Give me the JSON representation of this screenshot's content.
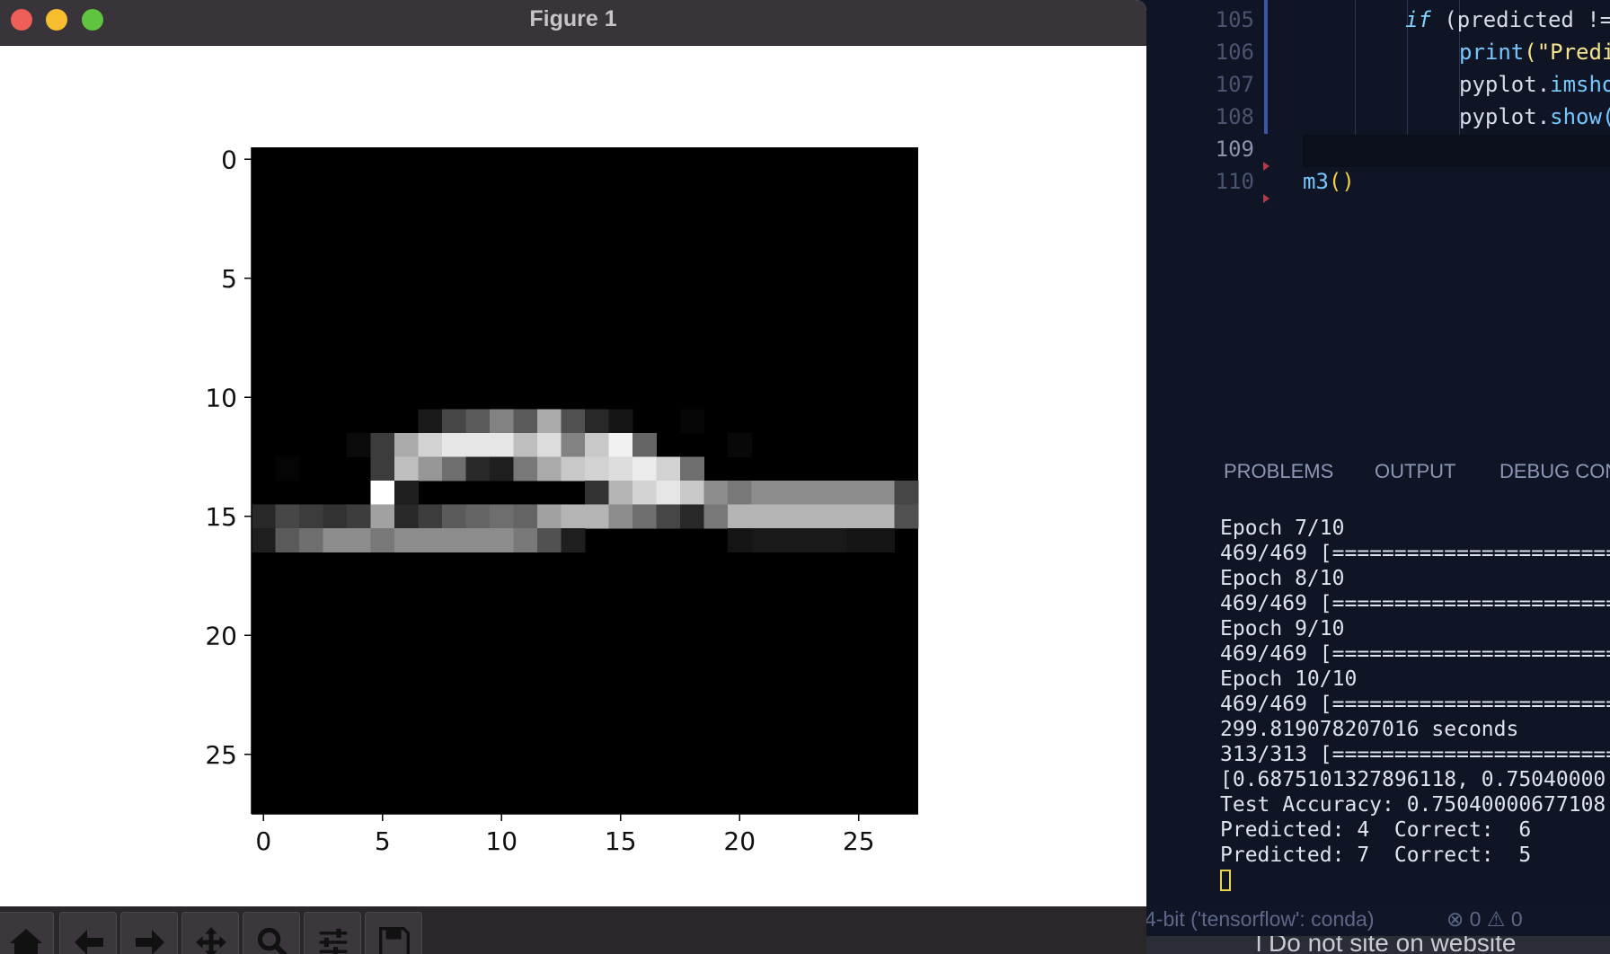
{
  "window": {
    "title": "Figure 1"
  },
  "chart_data": {
    "type": "heatmap",
    "colormap": "gray",
    "xticks": [
      0,
      5,
      10,
      15,
      20,
      25
    ],
    "yticks": [
      0,
      5,
      10,
      15,
      20,
      25
    ],
    "xlim": [
      -0.5,
      27.5
    ],
    "ylim": [
      27.5,
      -0.5
    ],
    "grid": false,
    "pixels": [
      {
        "y": 11,
        "x": 7,
        "v": 25
      },
      {
        "y": 11,
        "x": 8,
        "v": 70
      },
      {
        "y": 11,
        "x": 9,
        "v": 90
      },
      {
        "y": 11,
        "x": 10,
        "v": 130
      },
      {
        "y": 11,
        "x": 11,
        "v": 90
      },
      {
        "y": 11,
        "x": 12,
        "v": 170
      },
      {
        "y": 11,
        "x": 13,
        "v": 80
      },
      {
        "y": 11,
        "x": 14,
        "v": 40
      },
      {
        "y": 11,
        "x": 15,
        "v": 20
      },
      {
        "y": 11,
        "x": 18,
        "v": 6
      },
      {
        "y": 12,
        "x": 4,
        "v": 10
      },
      {
        "y": 12,
        "x": 5,
        "v": 60
      },
      {
        "y": 12,
        "x": 6,
        "v": 170
      },
      {
        "y": 12,
        "x": 7,
        "v": 210
      },
      {
        "y": 12,
        "x": 8,
        "v": 230
      },
      {
        "y": 12,
        "x": 9,
        "v": 230
      },
      {
        "y": 12,
        "x": 10,
        "v": 230
      },
      {
        "y": 12,
        "x": 11,
        "v": 190
      },
      {
        "y": 12,
        "x": 12,
        "v": 220
      },
      {
        "y": 12,
        "x": 13,
        "v": 130
      },
      {
        "y": 12,
        "x": 14,
        "v": 200
      },
      {
        "y": 12,
        "x": 15,
        "v": 240
      },
      {
        "y": 12,
        "x": 16,
        "v": 100
      },
      {
        "y": 12,
        "x": 20,
        "v": 8
      },
      {
        "y": 13,
        "x": 1,
        "v": 5
      },
      {
        "y": 13,
        "x": 5,
        "v": 60
      },
      {
        "y": 13,
        "x": 6,
        "v": 190
      },
      {
        "y": 13,
        "x": 7,
        "v": 150
      },
      {
        "y": 13,
        "x": 8,
        "v": 110
      },
      {
        "y": 13,
        "x": 9,
        "v": 40
      },
      {
        "y": 13,
        "x": 10,
        "v": 30
      },
      {
        "y": 13,
        "x": 11,
        "v": 120
      },
      {
        "y": 13,
        "x": 12,
        "v": 170
      },
      {
        "y": 13,
        "x": 13,
        "v": 200
      },
      {
        "y": 13,
        "x": 14,
        "v": 210
      },
      {
        "y": 13,
        "x": 15,
        "v": 220
      },
      {
        "y": 13,
        "x": 16,
        "v": 235
      },
      {
        "y": 13,
        "x": 17,
        "v": 210
      },
      {
        "y": 13,
        "x": 18,
        "v": 110
      },
      {
        "y": 14,
        "x": 5,
        "v": 255
      },
      {
        "y": 14,
        "x": 6,
        "v": 30
      },
      {
        "y": 14,
        "x": 14,
        "v": 50
      },
      {
        "y": 14,
        "x": 15,
        "v": 180
      },
      {
        "y": 14,
        "x": 16,
        "v": 210
      },
      {
        "y": 14,
        "x": 17,
        "v": 230
      },
      {
        "y": 14,
        "x": 18,
        "v": 200
      },
      {
        "y": 14,
        "x": 19,
        "v": 140
      },
      {
        "y": 14,
        "x": 20,
        "v": 120
      },
      {
        "y": 14,
        "x": 21,
        "v": 140
      },
      {
        "y": 14,
        "x": 22,
        "v": 140
      },
      {
        "y": 14,
        "x": 23,
        "v": 140
      },
      {
        "y": 14,
        "x": 24,
        "v": 140
      },
      {
        "y": 14,
        "x": 25,
        "v": 140
      },
      {
        "y": 14,
        "x": 26,
        "v": 140
      },
      {
        "y": 14,
        "x": 27,
        "v": 70
      },
      {
        "y": 15,
        "x": 0,
        "v": 40
      },
      {
        "y": 15,
        "x": 1,
        "v": 70
      },
      {
        "y": 15,
        "x": 2,
        "v": 60
      },
      {
        "y": 15,
        "x": 3,
        "v": 50
      },
      {
        "y": 15,
        "x": 4,
        "v": 60
      },
      {
        "y": 15,
        "x": 5,
        "v": 160
      },
      {
        "y": 15,
        "x": 6,
        "v": 40
      },
      {
        "y": 15,
        "x": 7,
        "v": 60
      },
      {
        "y": 15,
        "x": 8,
        "v": 90
      },
      {
        "y": 15,
        "x": 9,
        "v": 100
      },
      {
        "y": 15,
        "x": 10,
        "v": 110
      },
      {
        "y": 15,
        "x": 11,
        "v": 100
      },
      {
        "y": 15,
        "x": 12,
        "v": 160
      },
      {
        "y": 15,
        "x": 13,
        "v": 180
      },
      {
        "y": 15,
        "x": 14,
        "v": 180
      },
      {
        "y": 15,
        "x": 15,
        "v": 140
      },
      {
        "y": 15,
        "x": 16,
        "v": 110
      },
      {
        "y": 15,
        "x": 17,
        "v": 70
      },
      {
        "y": 15,
        "x": 18,
        "v": 40
      },
      {
        "y": 15,
        "x": 19,
        "v": 120
      },
      {
        "y": 15,
        "x": 20,
        "v": 180
      },
      {
        "y": 15,
        "x": 21,
        "v": 180
      },
      {
        "y": 15,
        "x": 22,
        "v": 180
      },
      {
        "y": 15,
        "x": 23,
        "v": 180
      },
      {
        "y": 15,
        "x": 24,
        "v": 180
      },
      {
        "y": 15,
        "x": 25,
        "v": 180
      },
      {
        "y": 15,
        "x": 26,
        "v": 180
      },
      {
        "y": 15,
        "x": 27,
        "v": 80
      },
      {
        "y": 16,
        "x": 0,
        "v": 30
      },
      {
        "y": 16,
        "x": 1,
        "v": 90
      },
      {
        "y": 16,
        "x": 2,
        "v": 110
      },
      {
        "y": 16,
        "x": 3,
        "v": 140
      },
      {
        "y": 16,
        "x": 4,
        "v": 140
      },
      {
        "y": 16,
        "x": 5,
        "v": 120
      },
      {
        "y": 16,
        "x": 6,
        "v": 140
      },
      {
        "y": 16,
        "x": 7,
        "v": 140
      },
      {
        "y": 16,
        "x": 8,
        "v": 140
      },
      {
        "y": 16,
        "x": 9,
        "v": 140
      },
      {
        "y": 16,
        "x": 10,
        "v": 140
      },
      {
        "y": 16,
        "x": 11,
        "v": 120
      },
      {
        "y": 16,
        "x": 12,
        "v": 80
      },
      {
        "y": 16,
        "x": 13,
        "v": 30
      },
      {
        "y": 16,
        "x": 20,
        "v": 20
      },
      {
        "y": 16,
        "x": 21,
        "v": 25
      },
      {
        "y": 16,
        "x": 22,
        "v": 25
      },
      {
        "y": 16,
        "x": 23,
        "v": 25
      },
      {
        "y": 16,
        "x": 24,
        "v": 25
      },
      {
        "y": 16,
        "x": 25,
        "v": 20
      },
      {
        "y": 16,
        "x": 26,
        "v": 20
      }
    ]
  },
  "toolbar": {
    "buttons": [
      {
        "name": "home-button",
        "icon": "home-icon"
      },
      {
        "name": "back-button",
        "icon": "arrow-left-icon"
      },
      {
        "name": "forward-button",
        "icon": "arrow-right-icon"
      },
      {
        "name": "pan-button",
        "icon": "move-icon"
      },
      {
        "name": "zoom-button",
        "icon": "magnifier-icon"
      },
      {
        "name": "configure-button",
        "icon": "sliders-icon"
      },
      {
        "name": "save-button",
        "icon": "floppy-icon"
      }
    ]
  },
  "editor": {
    "lines": [
      {
        "num": "105",
        "kw": "if",
        "rest": " (predicted !="
      },
      {
        "num": "106",
        "fn": "print",
        "str": "(\"Predi"
      },
      {
        "num": "107",
        "obj": "pyplot.",
        "fn": "imsho"
      },
      {
        "num": "108",
        "obj": "pyplot.",
        "fn": "show("
      },
      {
        "num": "109"
      },
      {
        "num": "110",
        "code": "m3",
        "paren": "()"
      }
    ]
  },
  "panel": {
    "tabs": [
      "PROBLEMS",
      "OUTPUT",
      "DEBUG CON"
    ],
    "terminal_lines": [
      "Epoch 7/10",
      "469/469 [==============================",
      "Epoch 8/10",
      "469/469 [==============================",
      "Epoch 9/10",
      "469/469 [==============================",
      "Epoch 10/10",
      "469/469 [==============================",
      "299.819078207016 seconds",
      "313/313 [==============================",
      "[0.6875101327896118, 0.75040000",
      "Test Accuracy: 0.75040000677108",
      "Predicted: 4  Correct:  6",
      "Predicted: 7  Correct:  5"
    ]
  },
  "statusbar": {
    "interpreter": "4-bit ('tensorflow': conda)",
    "errors": "0",
    "warnings": "0"
  },
  "bottom_strip": {
    "text": "l Do not site on website"
  }
}
